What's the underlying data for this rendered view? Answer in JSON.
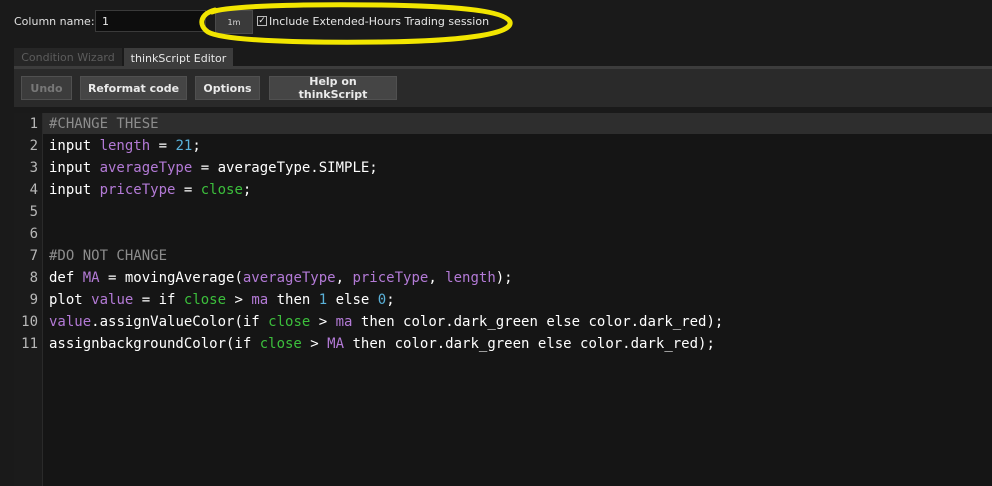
{
  "top_bar": {
    "column_label": "Column name:",
    "column_value": "1",
    "aggregation": "1m",
    "extended_hours_label": "Include Extended-Hours Trading session",
    "extended_hours_checked": true,
    "highlight_color": "#f2e600"
  },
  "tabs": [
    {
      "label": "Condition Wizard",
      "active": false
    },
    {
      "label": "thinkScript Editor",
      "active": true
    }
  ],
  "toolbar": {
    "undo": "Undo",
    "reformat": "Reformat code",
    "options": "Options",
    "help": "Help on thinkScript"
  },
  "editor": {
    "line_numbers": [
      "1",
      "2",
      "3",
      "4",
      "5",
      "6",
      "7",
      "8",
      "9",
      "10",
      "11"
    ],
    "lines": [
      [
        {
          "t": "#CHANGE THESE",
          "c": "cm"
        }
      ],
      [
        {
          "t": "input ",
          "c": "kw"
        },
        {
          "t": "length",
          "c": "var"
        },
        {
          "t": " = ",
          "c": "kw"
        },
        {
          "t": "21",
          "c": "num"
        },
        {
          "t": ";",
          "c": "kw"
        }
      ],
      [
        {
          "t": "input ",
          "c": "kw"
        },
        {
          "t": "averageType",
          "c": "var"
        },
        {
          "t": " = averageType.SIMPLE;",
          "c": "kw"
        }
      ],
      [
        {
          "t": "input ",
          "c": "kw"
        },
        {
          "t": "priceType",
          "c": "var"
        },
        {
          "t": " = ",
          "c": "kw"
        },
        {
          "t": "close",
          "c": "cl"
        },
        {
          "t": ";",
          "c": "kw"
        }
      ],
      [],
      [],
      [
        {
          "t": "#DO NOT CHANGE",
          "c": "cm"
        }
      ],
      [
        {
          "t": "def ",
          "c": "kw"
        },
        {
          "t": "MA",
          "c": "var"
        },
        {
          "t": " = movingAverage(",
          "c": "kw"
        },
        {
          "t": "averageType",
          "c": "var"
        },
        {
          "t": ", ",
          "c": "kw"
        },
        {
          "t": "priceType",
          "c": "var"
        },
        {
          "t": ", ",
          "c": "kw"
        },
        {
          "t": "length",
          "c": "var"
        },
        {
          "t": ");",
          "c": "kw"
        }
      ],
      [
        {
          "t": "plot ",
          "c": "kw"
        },
        {
          "t": "value",
          "c": "var"
        },
        {
          "t": " = if ",
          "c": "kw"
        },
        {
          "t": "close",
          "c": "cl"
        },
        {
          "t": " > ",
          "c": "kw"
        },
        {
          "t": "ma",
          "c": "var"
        },
        {
          "t": " then ",
          "c": "kw"
        },
        {
          "t": "1",
          "c": "num"
        },
        {
          "t": " else ",
          "c": "kw"
        },
        {
          "t": "0",
          "c": "num"
        },
        {
          "t": ";",
          "c": "kw"
        }
      ],
      [
        {
          "t": "value",
          "c": "var"
        },
        {
          "t": ".assignValueColor(if ",
          "c": "kw"
        },
        {
          "t": "close",
          "c": "cl"
        },
        {
          "t": " > ",
          "c": "kw"
        },
        {
          "t": "ma",
          "c": "var"
        },
        {
          "t": " then color.dark_green else color.dark_red);",
          "c": "kw"
        }
      ],
      [
        {
          "t": "assignbackgroundColor(if ",
          "c": "kw"
        },
        {
          "t": "close",
          "c": "cl"
        },
        {
          "t": " > ",
          "c": "kw"
        },
        {
          "t": "MA",
          "c": "var"
        },
        {
          "t": " then color.dark_green else color.dark_red);",
          "c": "kw"
        }
      ]
    ]
  }
}
